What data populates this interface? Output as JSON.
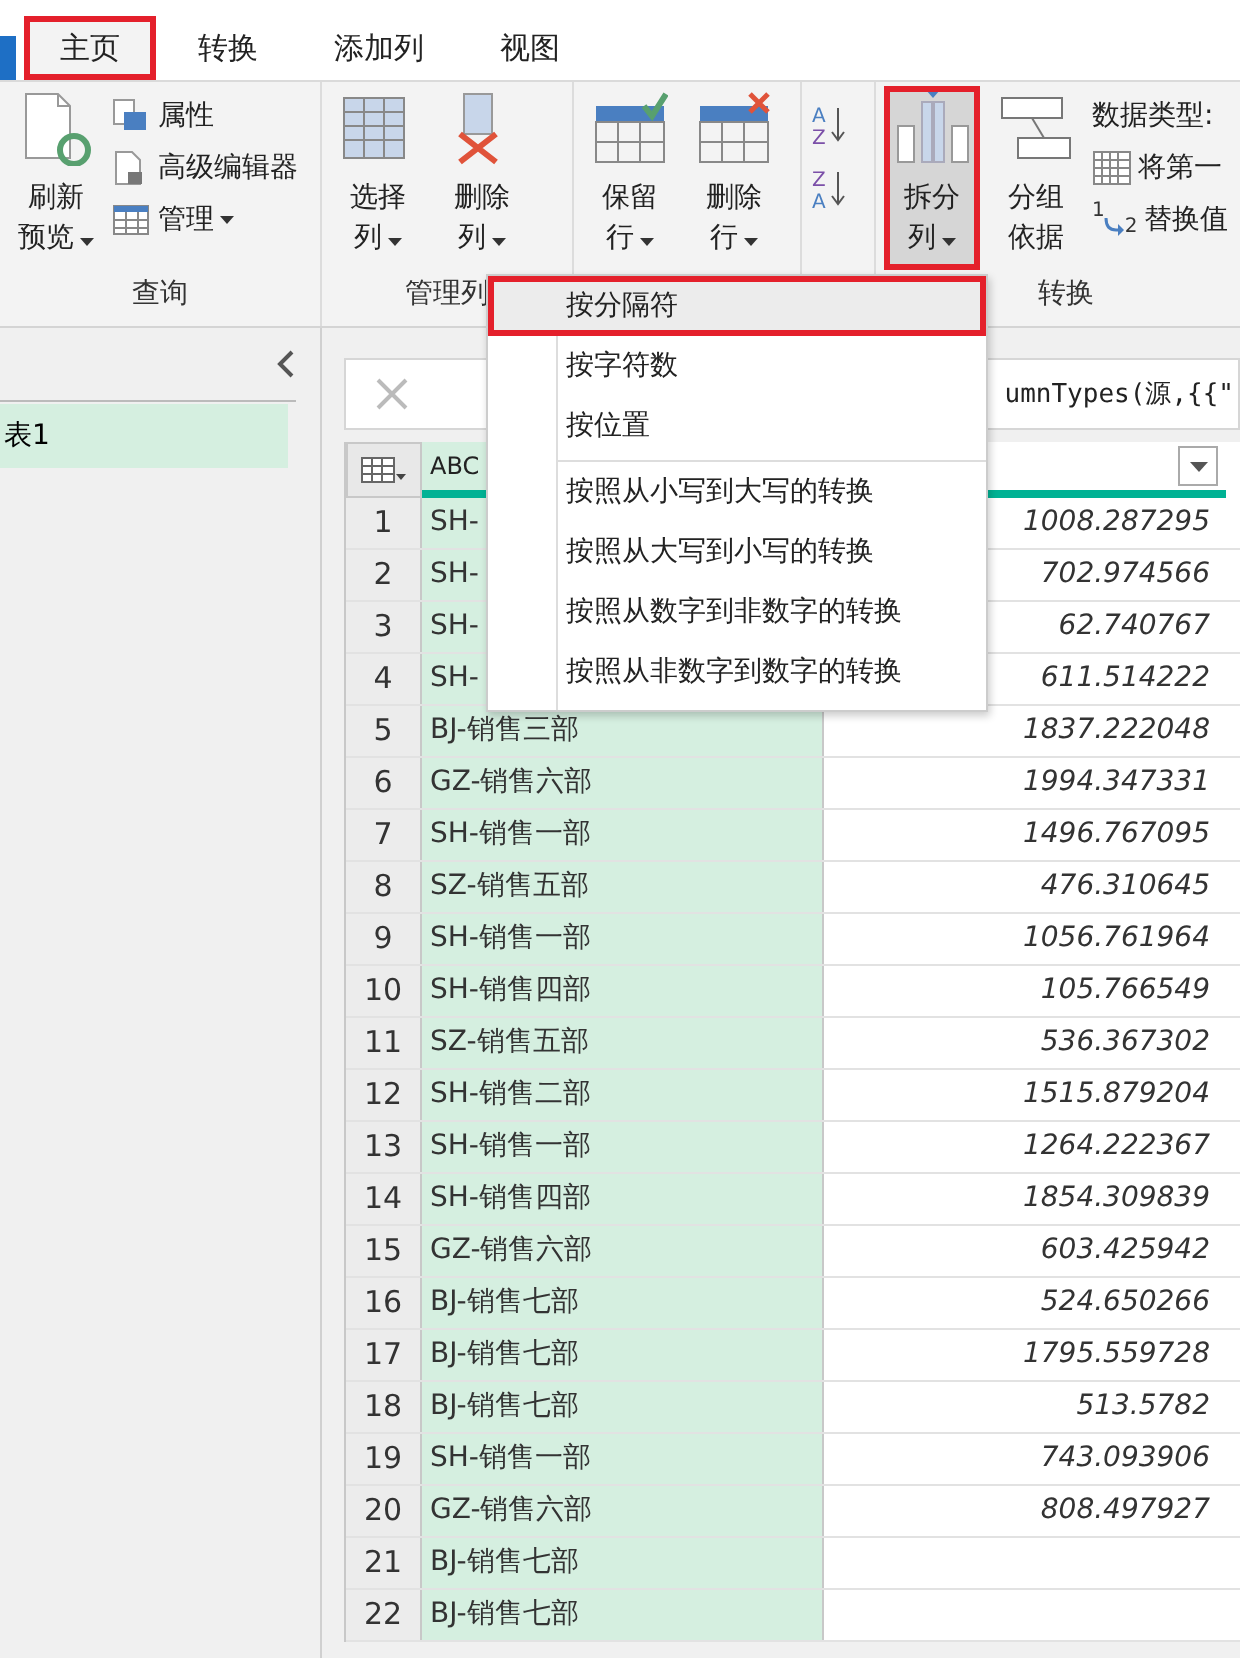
{
  "tabs": [
    {
      "label": "主页",
      "selected": true,
      "annotated": true
    },
    {
      "label": "转换",
      "selected": false,
      "annotated": false
    },
    {
      "label": "添加列",
      "selected": false,
      "annotated": false
    },
    {
      "label": "视图",
      "selected": false,
      "annotated": false
    }
  ],
  "ribbon": {
    "groups": [
      {
        "label": "查询",
        "items": [
          {
            "kind": "large",
            "lines": [
              "刷新",
              "预览"
            ],
            "dropdown": true,
            "selected": false,
            "annotated": false
          },
          {
            "kind": "stack",
            "entries": [
              {
                "label": "属性",
                "dropdown": false
              },
              {
                "label": "高级编辑器",
                "dropdown": false
              },
              {
                "label": "管理",
                "dropdown": true
              }
            ]
          }
        ]
      },
      {
        "label": "管理列",
        "items": [
          {
            "kind": "large",
            "lines": [
              "选择",
              "列"
            ],
            "dropdown": true,
            "selected": false,
            "annotated": false
          },
          {
            "kind": "large",
            "lines": [
              "删除",
              "列"
            ],
            "dropdown": true,
            "selected": false,
            "annotated": false
          }
        ]
      },
      {
        "items": [
          {
            "kind": "large",
            "lines": [
              "保留",
              "行"
            ],
            "dropdown": true,
            "selected": false,
            "annotated": false
          },
          {
            "kind": "large",
            "lines": [
              "删除",
              "行"
            ],
            "dropdown": true,
            "selected": false,
            "annotated": false
          }
        ]
      },
      {
        "items": [
          {
            "kind": "sort",
            "buttons": [
              {
                "upper": "A",
                "lower": "Z"
              },
              {
                "upper": "Z",
                "lower": "A"
              }
            ]
          }
        ]
      },
      {
        "label": "转换",
        "items": [
          {
            "kind": "large",
            "lines": [
              "拆分",
              "列"
            ],
            "dropdown": true,
            "selected": true,
            "annotated": true
          },
          {
            "kind": "large",
            "lines": [
              "分组",
              "依据"
            ],
            "dropdown": false,
            "selected": false,
            "annotated": false
          },
          {
            "kind": "stack",
            "entries": [
              {
                "label": "数据类型:",
                "dropdown": false
              },
              {
                "label": "将第一",
                "dropdown": false
              },
              {
                "label": "替换值",
                "dropdown": false,
                "marks": [
                  "1",
                  "2"
                ]
              }
            ]
          }
        ]
      }
    ]
  },
  "queries": {
    "items": [
      {
        "label": "表1",
        "selected": true
      }
    ]
  },
  "formula": "umnTypes(源,{{\"",
  "menu": {
    "items": [
      {
        "label": "按分隔符",
        "selected": true,
        "annotated": true,
        "separator_before": false
      },
      {
        "label": "按字符数",
        "selected": false,
        "annotated": false,
        "separator_before": false
      },
      {
        "label": "按位置",
        "selected": false,
        "annotated": false,
        "separator_before": false
      },
      {
        "label": "按照从小写到大写的转换",
        "selected": false,
        "annotated": false,
        "separator_before": true
      },
      {
        "label": "按照从大写到小写的转换",
        "selected": false,
        "annotated": false,
        "separator_before": false
      },
      {
        "label": "按照从数字到非数字的转换",
        "selected": false,
        "annotated": false,
        "separator_before": false
      },
      {
        "label": "按照从非数字到数字的转换",
        "selected": false,
        "annotated": false,
        "separator_before": false
      }
    ]
  },
  "table": {
    "type_label": "ABC",
    "rows": [
      {
        "num": "1",
        "dept": "SH-",
        "value": "1008.287295"
      },
      {
        "num": "2",
        "dept": "SH-",
        "value": "702.974566"
      },
      {
        "num": "3",
        "dept": "SH-",
        "value": "62.740767"
      },
      {
        "num": "4",
        "dept": "SH-",
        "value": "611.514222"
      },
      {
        "num": "5",
        "dept": "BJ-销售三部",
        "value": "1837.222048"
      },
      {
        "num": "6",
        "dept": "GZ-销售六部",
        "value": "1994.347331"
      },
      {
        "num": "7",
        "dept": "SH-销售一部",
        "value": "1496.767095"
      },
      {
        "num": "8",
        "dept": "SZ-销售五部",
        "value": "476.310645"
      },
      {
        "num": "9",
        "dept": "SH-销售一部",
        "value": "1056.761964"
      },
      {
        "num": "10",
        "dept": "SH-销售四部",
        "value": "105.766549"
      },
      {
        "num": "11",
        "dept": "SZ-销售五部",
        "value": "536.367302"
      },
      {
        "num": "12",
        "dept": "SH-销售二部",
        "value": "1515.879204"
      },
      {
        "num": "13",
        "dept": "SH-销售一部",
        "value": "1264.222367"
      },
      {
        "num": "14",
        "dept": "SH-销售四部",
        "value": "1854.309839"
      },
      {
        "num": "15",
        "dept": "GZ-销售六部",
        "value": "603.425942"
      },
      {
        "num": "16",
        "dept": "BJ-销售七部",
        "value": "524.650266"
      },
      {
        "num": "17",
        "dept": "BJ-销售七部",
        "value": "1795.559728"
      },
      {
        "num": "18",
        "dept": "BJ-销售七部",
        "value": "513.5782"
      },
      {
        "num": "19",
        "dept": "SH-销售一部",
        "value": "743.093906"
      },
      {
        "num": "20",
        "dept": "GZ-销售六部",
        "value": "808.497927"
      },
      {
        "num": "21",
        "dept": "BJ-销售七部"
      },
      {
        "num": "22",
        "dept": "BJ-销售七部"
      }
    ]
  }
}
